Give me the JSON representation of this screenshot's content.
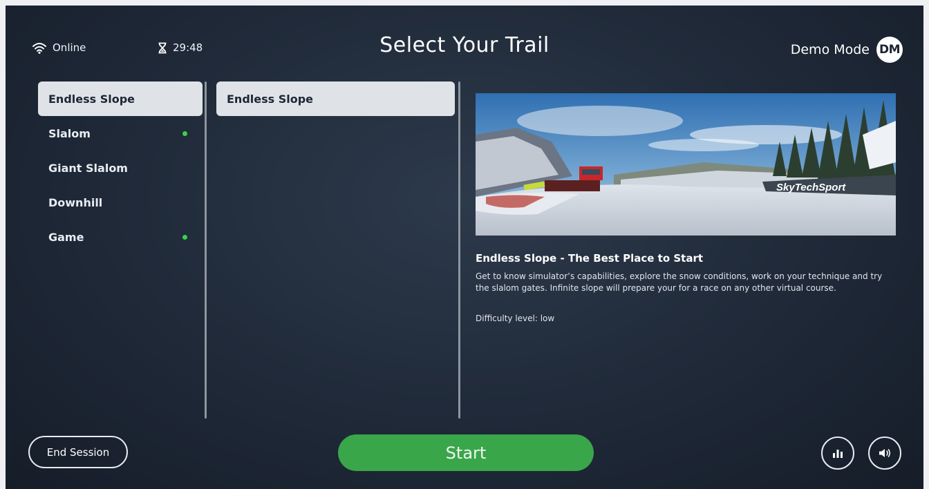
{
  "header": {
    "connection_status": "Online",
    "timer": "29:48",
    "title": "Select Your Trail",
    "mode_label": "Demo Mode",
    "avatar_initials": "DM"
  },
  "categories": [
    {
      "label": "Endless Slope",
      "selected": true,
      "has_dot": false
    },
    {
      "label": "Slalom",
      "selected": false,
      "has_dot": true
    },
    {
      "label": "Giant Slalom",
      "selected": false,
      "has_dot": false
    },
    {
      "label": "Downhill",
      "selected": false,
      "has_dot": false
    },
    {
      "label": "Game",
      "selected": false,
      "has_dot": true
    }
  ],
  "trails": [
    {
      "label": "Endless Slope",
      "selected": true
    }
  ],
  "detail": {
    "preview_logo": "SkyTechSport",
    "title": "Endless Slope - The Best Place to Start",
    "description": "Get to know simulator’s capabilities, explore the snow conditions, work on your technique and try the slalom gates. Infinite slope will prepare your for a race on any other virtual course.",
    "difficulty": "Difficulty level: low"
  },
  "footer": {
    "end_session_label": "End Session",
    "start_label": "Start",
    "stats_icon": "bar-chart-icon",
    "sound_icon": "speaker-icon"
  },
  "colors": {
    "accent_green": "#3aa64a",
    "indicator_dot": "#39d24a",
    "selected_bg": "#dfe3e8"
  }
}
